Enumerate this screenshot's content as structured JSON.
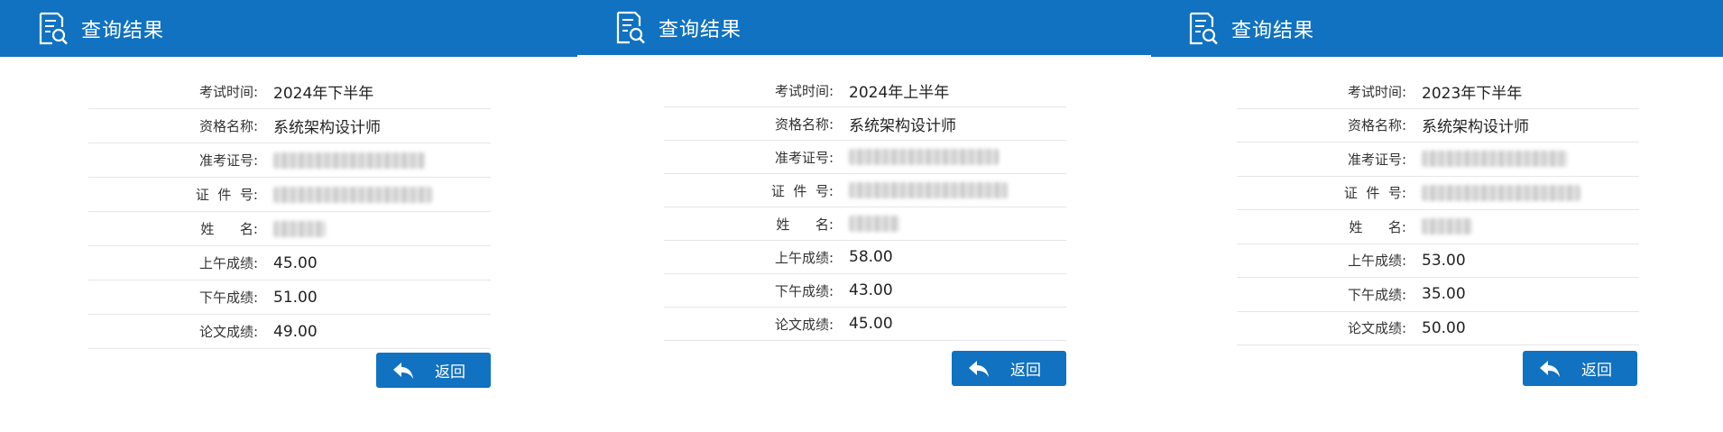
{
  "panels": [
    {
      "title": "查询结果",
      "rows": [
        {
          "label": "考试时间:",
          "value": "2024年下半年"
        },
        {
          "label": "资格名称:",
          "value": "系统架构设计师"
        },
        {
          "label": "准考证号:",
          "value": ""
        },
        {
          "label": "证  件  号:",
          "value": ""
        },
        {
          "label": "姓      名:",
          "value": ""
        },
        {
          "label": "上午成绩:",
          "value": "45.00"
        },
        {
          "label": "下午成绩:",
          "value": "51.00"
        },
        {
          "label": "论文成绩:",
          "value": "49.00"
        }
      ],
      "back_label": "返回"
    },
    {
      "title": "查询结果",
      "rows": [
        {
          "label": "考试时间:",
          "value": "2024年上半年"
        },
        {
          "label": "资格名称:",
          "value": "系统架构设计师"
        },
        {
          "label": "准考证号:",
          "value": ""
        },
        {
          "label": "证  件  号:",
          "value": ""
        },
        {
          "label": "姓      名:",
          "value": ""
        },
        {
          "label": "上午成绩:",
          "value": "58.00"
        },
        {
          "label": "下午成绩:",
          "value": "43.00"
        },
        {
          "label": "论文成绩:",
          "value": "45.00"
        }
      ],
      "back_label": "返回"
    },
    {
      "title": "查询结果",
      "rows": [
        {
          "label": "考试时间:",
          "value": "2023年下半年"
        },
        {
          "label": "资格名称:",
          "value": "系统架构设计师"
        },
        {
          "label": "准考证号:",
          "value": ""
        },
        {
          "label": "证  件  号:",
          "value": ""
        },
        {
          "label": "姓      名:",
          "value": ""
        },
        {
          "label": "上午成绩:",
          "value": "53.00"
        },
        {
          "label": "下午成绩:",
          "value": "35.00"
        },
        {
          "label": "论文成绩:",
          "value": "50.00"
        }
      ],
      "back_label": "返回"
    }
  ],
  "icons": {
    "header": "search-document-icon",
    "back": "reply-arrow-icon"
  },
  "colors": {
    "header_bg": "#1072c0",
    "button_bg": "#1072c0",
    "row_divider": "#e6e6e6"
  }
}
